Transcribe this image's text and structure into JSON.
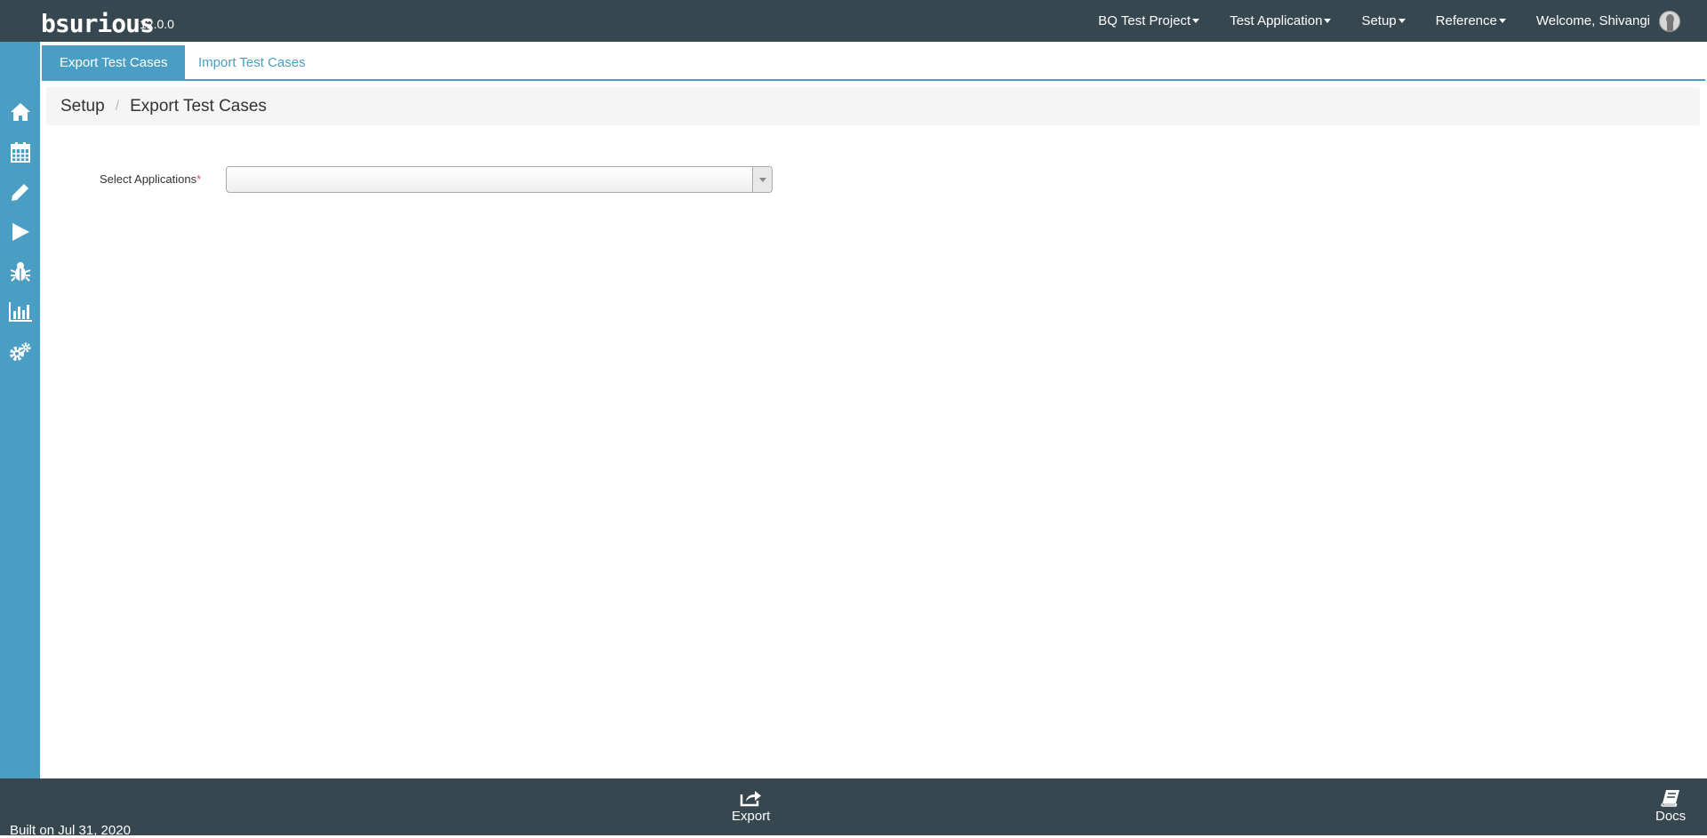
{
  "app": {
    "logo_text": "bsurious",
    "version": "12.0.0"
  },
  "topnav": {
    "project": "BQ Test Project",
    "application": "Test Application",
    "setup": "Setup",
    "reference": "Reference",
    "welcome": "Welcome, Shivangi"
  },
  "sidebar": {
    "items": [
      {
        "icon": "home-icon"
      },
      {
        "icon": "calendar-icon"
      },
      {
        "icon": "pencil-icon"
      },
      {
        "icon": "play-icon"
      },
      {
        "icon": "bug-icon"
      },
      {
        "icon": "bar-chart-icon"
      },
      {
        "icon": "gears-icon"
      }
    ]
  },
  "tabs": {
    "export": "Export Test Cases",
    "import": "Import Test Cases"
  },
  "breadcrumb": {
    "parent": "Setup",
    "separator": "/",
    "current": "Export Test Cases"
  },
  "form": {
    "select_label": "Select Applications",
    "required_mark": "*",
    "select_value": ""
  },
  "footer": {
    "built": "Built on Jul 31, 2020",
    "export": "Export",
    "docs": "Docs"
  },
  "colors": {
    "navbar": "#37474f",
    "sidebar": "#4a9ec4",
    "accent": "#4a9ec4"
  }
}
